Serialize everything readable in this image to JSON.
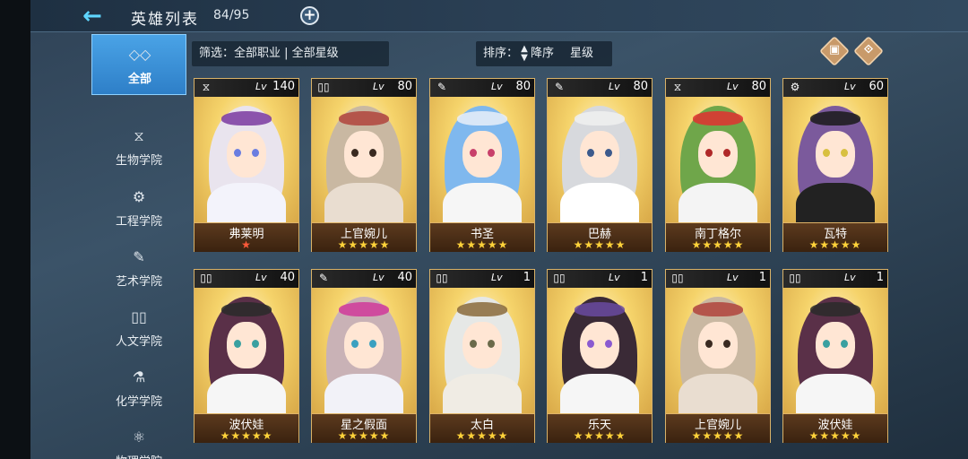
{
  "header": {
    "title": "英雄列表",
    "count": "84/95",
    "back_icon": "back-arrow-icon",
    "add_icon": "plus-icon"
  },
  "sidebar": {
    "items": [
      {
        "label": "全部",
        "icon": "◇◇",
        "active": true
      },
      {
        "label": "生物学院",
        "icon": "⧖"
      },
      {
        "label": "工程学院",
        "icon": "⚙"
      },
      {
        "label": "艺术学院",
        "icon": "✎"
      },
      {
        "label": "人文学院",
        "icon": "▯▯"
      },
      {
        "label": "化学学院",
        "icon": "⚗"
      },
      {
        "label": "物理学院",
        "icon": "⚛"
      }
    ]
  },
  "filter": {
    "label": "筛选：全部职业 | 全部星级"
  },
  "sort": {
    "label": "排序：",
    "order": "降序",
    "key": "星级"
  },
  "heroes": [
    {
      "name": "弗莱明",
      "level": "140",
      "class_icon": "dna-icon",
      "stars": "★",
      "star_color": "red",
      "hair": "#e9e4ee",
      "accent": "#7a3aa0",
      "eye": "#6a7de0",
      "outfit": "#f3f3fb"
    },
    {
      "name": "上官婉儿",
      "level": "80",
      "class_icon": "book-icon",
      "stars": "★★★★★",
      "hair": "#c9b8a2",
      "accent": "#b0433c",
      "eye": "#3a2a20",
      "outfit": "#e9ddd0"
    },
    {
      "name": "书圣",
      "level": "80",
      "class_icon": "palette-icon",
      "stars": "★★★★★",
      "hair": "#7fb8ee",
      "accent": "#e9eef8",
      "eye": "#c8406a",
      "outfit": "#f6f6f6"
    },
    {
      "name": "巴赫",
      "level": "80",
      "class_icon": "palette-icon",
      "stars": "★★★★★",
      "hair": "#d7d9dd",
      "accent": "#f0f0f0",
      "eye": "#3c5a8c",
      "outfit": "#ffffff"
    },
    {
      "name": "南丁格尔",
      "level": "80",
      "class_icon": "dna-icon",
      "stars": "★★★★★",
      "hair": "#6fa64a",
      "accent": "#e23030",
      "eye": "#b02828",
      "outfit": "#f4f4f4"
    },
    {
      "name": "瓦特",
      "level": "60",
      "class_icon": "robot-icon",
      "stars": "★★★★★",
      "hair": "#7b5a9c",
      "accent": "#1a1a1a",
      "eye": "#d8c040",
      "outfit": "#222222"
    },
    {
      "name": "波伏娃",
      "level": "40",
      "class_icon": "book-icon",
      "stars": "★★★★★",
      "hair": "#5a3048",
      "accent": "#2a2a2a",
      "eye": "#3aa0a0",
      "outfit": "#f6f6f6"
    },
    {
      "name": "星之假面",
      "level": "40",
      "class_icon": "palette-icon",
      "stars": "★★★★★",
      "hair": "#c9b2b6",
      "accent": "#d0389a",
      "eye": "#3aa0c0",
      "outfit": "#f2f2f8"
    },
    {
      "name": "太白",
      "level": "1",
      "class_icon": "book-icon",
      "stars": "★★★★★",
      "hair": "#e6e8e6",
      "accent": "#8a6a3a",
      "eye": "#6a6a4a",
      "outfit": "#f0ece4"
    },
    {
      "name": "乐天",
      "level": "1",
      "class_icon": "book-icon",
      "stars": "★★★★★",
      "hair": "#3a2a36",
      "accent": "#6a4aa0",
      "eye": "#8a5ad0",
      "outfit": "#f6f6f6"
    },
    {
      "name": "上官婉儿",
      "level": "1",
      "class_icon": "book-icon",
      "stars": "★★★★★",
      "hair": "#c9b8a2",
      "accent": "#b0433c",
      "eye": "#3a2a20",
      "outfit": "#e9ddd0"
    },
    {
      "name": "波伏娃",
      "level": "1",
      "class_icon": "book-icon",
      "stars": "★★★★★",
      "hair": "#5a3048",
      "accent": "#2a2a2a",
      "eye": "#3aa0a0",
      "outfit": "#f6f6f6"
    }
  ],
  "lv_label": "Lv",
  "class_glyphs": {
    "dna-icon": "⧖",
    "book-icon": "▯▯",
    "palette-icon": "✎",
    "robot-icon": "⚙"
  }
}
